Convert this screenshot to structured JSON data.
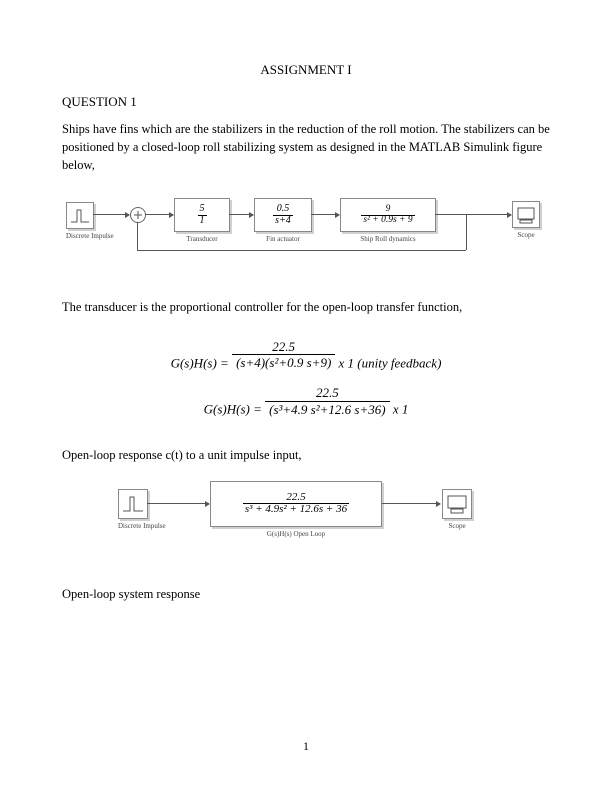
{
  "title": "ASSIGNMENT I",
  "question_head": "QUESTION 1",
  "para1": "Ships have fins which are the stabilizers in the reduction of the roll motion. The stabilizers can be positioned by a closed-loop roll stabilizing system as designed in the MATLAB Simulink figure below,",
  "diagram1": {
    "impulse_label": "Discrete Impulse",
    "blocks": [
      {
        "name": "Transducer",
        "num": "5",
        "den": "1"
      },
      {
        "name": "Fin actuator",
        "num": "0.5",
        "den": "s+4"
      },
      {
        "name": "Ship Roll dynamics",
        "num": "9",
        "den": "s² + 0.9s + 9"
      }
    ],
    "scope_label": "Scope"
  },
  "para2": "The transducer is the proportional controller for the open-loop transfer function,",
  "eq1": {
    "lhs": "G(s)H(s) =",
    "num": "22.5",
    "den": "(s+4)(s²+0.9 s+9)",
    "suffix": " x 1 (unity feedback)"
  },
  "eq2": {
    "lhs": "G(s)H(s) =",
    "num": "22.5",
    "den": "(s³+4.9 s²+12.6 s+36)",
    "suffix": " x 1"
  },
  "para3": "Open-loop response c(t) to a unit impulse input,",
  "diagram2": {
    "impulse_label": "Discrete Impulse",
    "tf_num": "22.5",
    "tf_den": "s³ + 4.9s² + 12.6s + 36",
    "tf_label": "G(s)H(s) Open Loop",
    "scope_label": "Scope"
  },
  "para4": "Open-loop system response",
  "page_number": "1"
}
